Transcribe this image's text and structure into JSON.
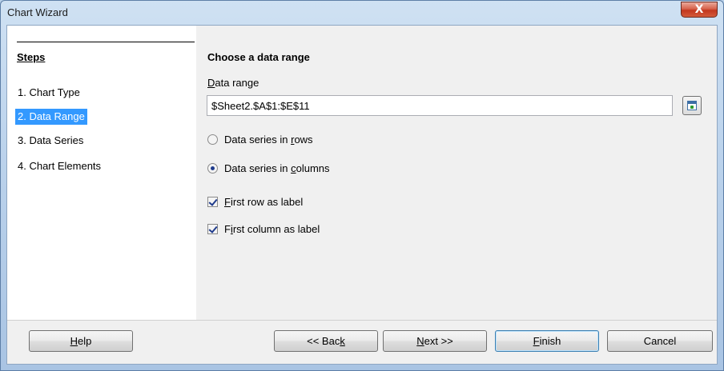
{
  "window": {
    "title": "Chart Wizard",
    "close_glyph": "X"
  },
  "steps": {
    "title": "Steps",
    "items": [
      {
        "label": "1. Chart Type",
        "active": false
      },
      {
        "label": "2. Data Range",
        "active": true
      },
      {
        "label": "3. Data Series",
        "active": false
      },
      {
        "label": "4. Chart Elements",
        "active": false
      }
    ]
  },
  "main": {
    "heading": "Choose a data range",
    "range_label_mn": "D",
    "range_label_rest": "ata range",
    "range_value": "$Sheet2.$A$1:$E$11",
    "range_button_icon": "select-range-icon",
    "options": {
      "rows_pre": "Data series in ",
      "rows_mn": "r",
      "rows_post": "ows",
      "rows_selected": false,
      "cols_pre": "Data series in ",
      "cols_mn": "c",
      "cols_post": "olumns",
      "cols_selected": true
    },
    "checks": {
      "first_row_mn": "F",
      "first_row_rest": "irst row as label",
      "first_row_checked": true,
      "first_col_pre": "F",
      "first_col_mn": "i",
      "first_col_rest": "rst column as label",
      "first_col_checked": true
    }
  },
  "buttons": {
    "help_mn": "H",
    "help_rest": "elp",
    "back_pre": "<< Bac",
    "back_mn": "k",
    "next_mn": "N",
    "next_rest": "ext >>",
    "finish_mn": "F",
    "finish_rest": "inish",
    "cancel": "Cancel"
  },
  "colors": {
    "selection": "#3399ff",
    "frame": "#bcd3ec",
    "close": "#c2371f"
  }
}
